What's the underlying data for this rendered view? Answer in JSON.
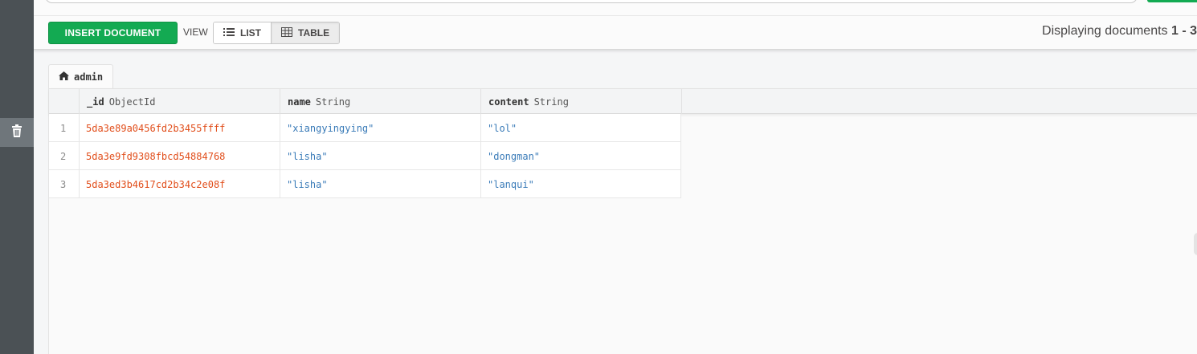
{
  "toolbar": {
    "insert_label": "INSERT DOCUMENT",
    "view_label": "VIEW",
    "list_label": "LIST",
    "table_label": "TABLE",
    "displaying_prefix": "Displaying documents ",
    "displaying_range": "1 - 3"
  },
  "tab": {
    "label": "admin",
    "icon": "home-icon"
  },
  "sidebar": {
    "icon": "trash-icon"
  },
  "table": {
    "columns": [
      {
        "field": "_id",
        "type": "ObjectId"
      },
      {
        "field": "name",
        "type": "String"
      },
      {
        "field": "content",
        "type": "String"
      }
    ],
    "rows": [
      {
        "num": "1",
        "id": "5da3e89a0456fd2b3455ffff",
        "name": "\"xiangyingying\"",
        "content": "\"lol\""
      },
      {
        "num": "2",
        "id": "5da3e9fd9308fbcd54884768",
        "name": "\"lisha\"",
        "content": "\"dongman\""
      },
      {
        "num": "3",
        "id": "5da3ed3b4617cd2b34c2e08f",
        "name": "\"lisha\"",
        "content": "\"lanqui\""
      }
    ]
  },
  "colors": {
    "accent_green": "#13aa52",
    "objectid_text": "#e14e1b",
    "string_text": "#3a7bb8",
    "rail": "#4b5155"
  }
}
